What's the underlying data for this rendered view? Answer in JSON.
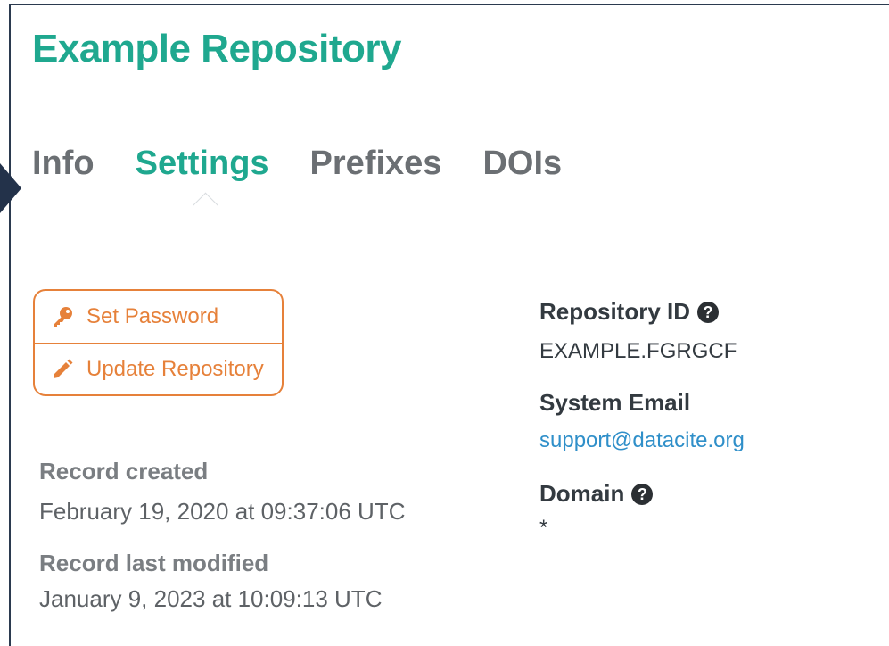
{
  "header": {
    "title": "Example Repository"
  },
  "tabs": [
    {
      "label": "Info",
      "active": false
    },
    {
      "label": "Settings",
      "active": true
    },
    {
      "label": "Prefixes",
      "active": false
    },
    {
      "label": "DOIs",
      "active": false
    }
  ],
  "actions": {
    "set_password": {
      "label": "Set Password",
      "icon": "key-icon"
    },
    "update_repository": {
      "label": "Update Repository",
      "icon": "pencil-icon"
    }
  },
  "record": {
    "created_label": "Record created",
    "created_value": "February 19, 2020 at 09:37:06 UTC",
    "modified_label": "Record last modified",
    "modified_value": "January 9, 2023 at 10:09:13 UTC"
  },
  "details": {
    "repository_id_label": "Repository ID",
    "repository_id_value": "EXAMPLE.FGRGCF",
    "system_email_label": "System Email",
    "system_email_value": "support@datacite.org",
    "domain_label": "Domain",
    "domain_value": "*",
    "help_icon": "?"
  },
  "colors": {
    "accent": "#1fa88f",
    "action": "#e6813a",
    "link": "#2f8fc9"
  }
}
